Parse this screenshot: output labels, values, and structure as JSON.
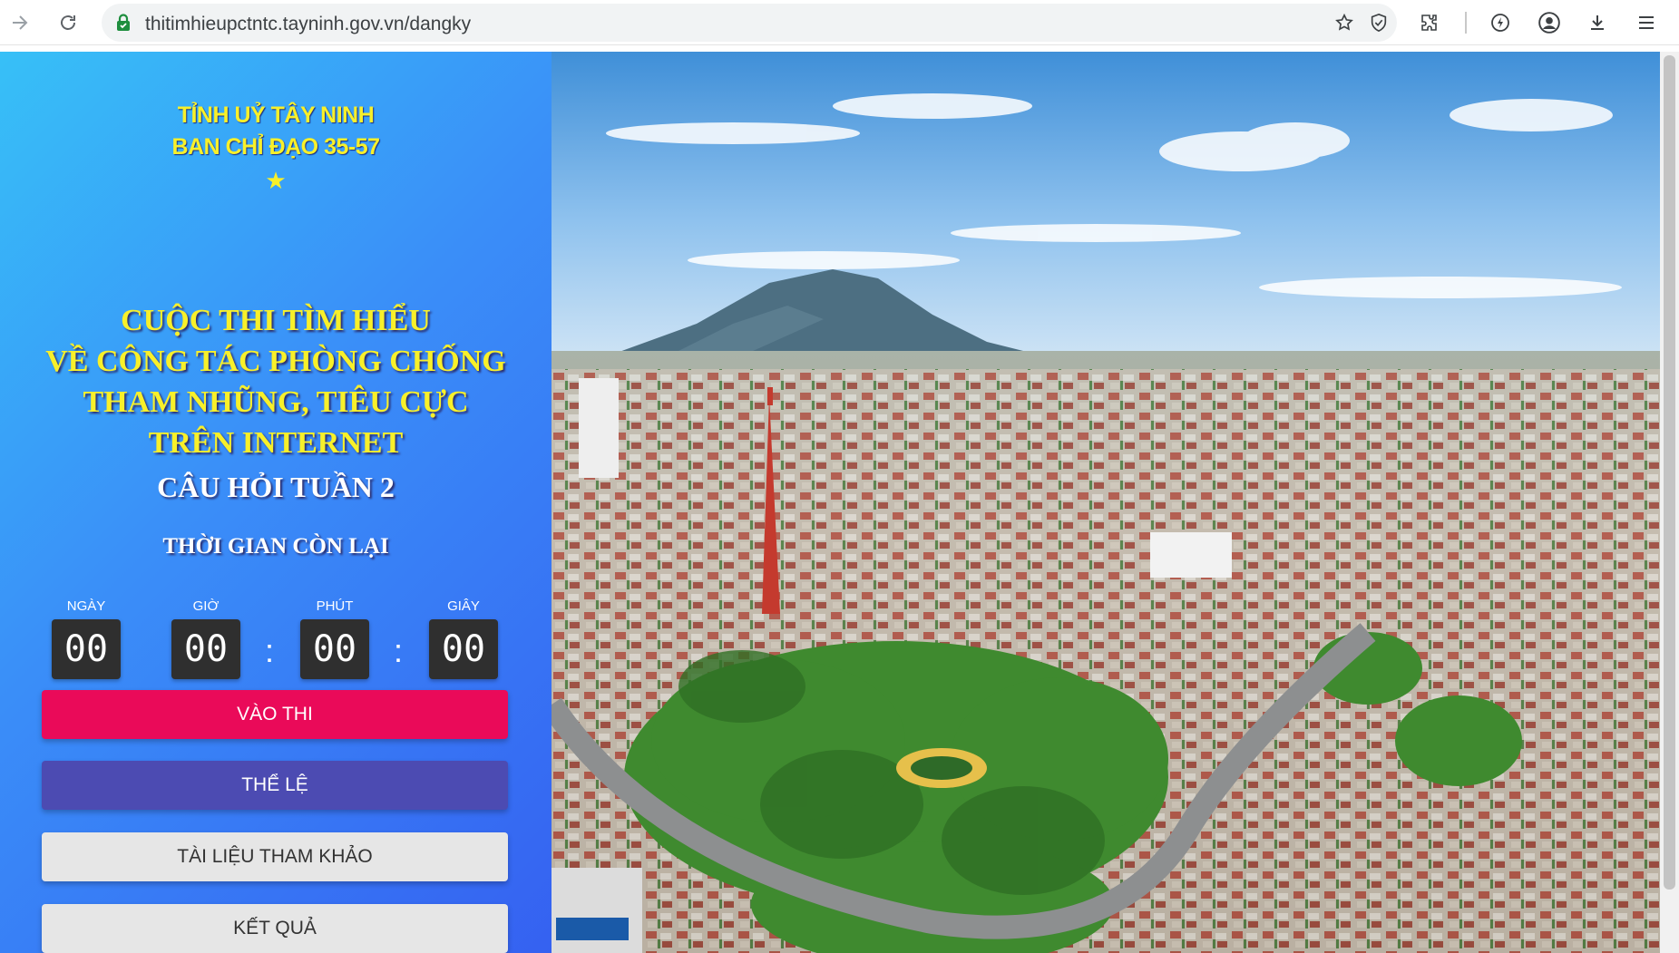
{
  "browser": {
    "url": "thitimhieupctntc.tayninh.gov.vn/dangky"
  },
  "header": {
    "org_line1": "TỈNH UỶ TÂY NINH",
    "org_line2": "BAN CHỈ ĐẠO 35-57",
    "star": "★"
  },
  "contest": {
    "title_lines": [
      "CUỘC THI TÌM HIỂU",
      "VỀ CÔNG TÁC PHÒNG CHỐNG",
      "THAM NHŨNG, TIÊU CỰC",
      "TRÊN INTERNET"
    ],
    "week": "CÂU HỎI TUẦN 2",
    "time_remaining_label": "THỜI GIAN CÒN LẠI"
  },
  "countdown": {
    "days_label": "NGÀY",
    "days": "00",
    "hours_label": "GIỜ",
    "hours": "00",
    "minutes_label": "PHÚT",
    "minutes": "00",
    "seconds_label": "GIÂY",
    "seconds": "00",
    "separator": ":"
  },
  "buttons": {
    "enter": "VÀO THI",
    "rules": "THỂ LỆ",
    "documents": "TÀI LIỆU THAM KHẢO",
    "results": "KẾT QUẢ"
  },
  "colors": {
    "enter_button": "#ea0a59",
    "rules_button": "#4c4bb2",
    "title_yellow": "#f8f02a",
    "panel_gradient_start": "#37c0f7",
    "panel_gradient_end": "#3561f1"
  },
  "icons": {
    "forward": "arrow-forward-icon",
    "reload": "reload-icon",
    "secure": "lock-icon",
    "bookmark": "star-icon",
    "shield": "shield-icon",
    "extensions": "puzzle-icon",
    "performance": "bolt-icon",
    "profile": "account-icon",
    "downloads": "download-icon",
    "menu": "hamburger-menu-icon"
  }
}
